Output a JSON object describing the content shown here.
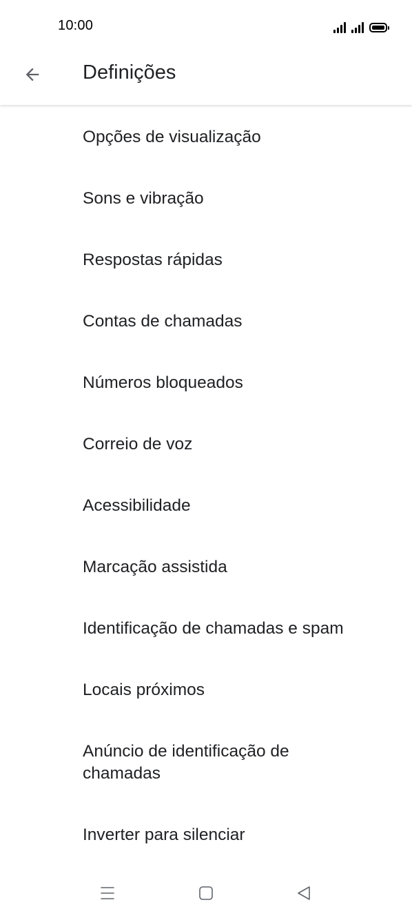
{
  "status_bar": {
    "time": "10:00",
    "icons": [
      "signal-icon",
      "signal-icon",
      "battery-icon"
    ]
  },
  "app_bar": {
    "back_icon": "arrow-left-icon",
    "title": "Definições"
  },
  "settings": {
    "items": [
      {
        "label": "Opções de visualização"
      },
      {
        "label": "Sons e vibração"
      },
      {
        "label": "Respostas rápidas"
      },
      {
        "label": "Contas de chamadas"
      },
      {
        "label": "Números bloqueados"
      },
      {
        "label": "Correio de voz"
      },
      {
        "label": "Acessibilidade"
      },
      {
        "label": "Marcação assistida"
      },
      {
        "label": "Identificação de chamadas e spam"
      },
      {
        "label": "Locais próximos"
      },
      {
        "label": "Anúncio de identificação de chamadas"
      },
      {
        "label": "Inverter para silenciar"
      }
    ]
  },
  "nav_bar": {
    "icons": [
      "menu-icon",
      "home-icon",
      "back-triangle-icon"
    ]
  },
  "colors": {
    "text_primary": "#202124",
    "icon": "#5f6368",
    "background": "#ffffff"
  }
}
